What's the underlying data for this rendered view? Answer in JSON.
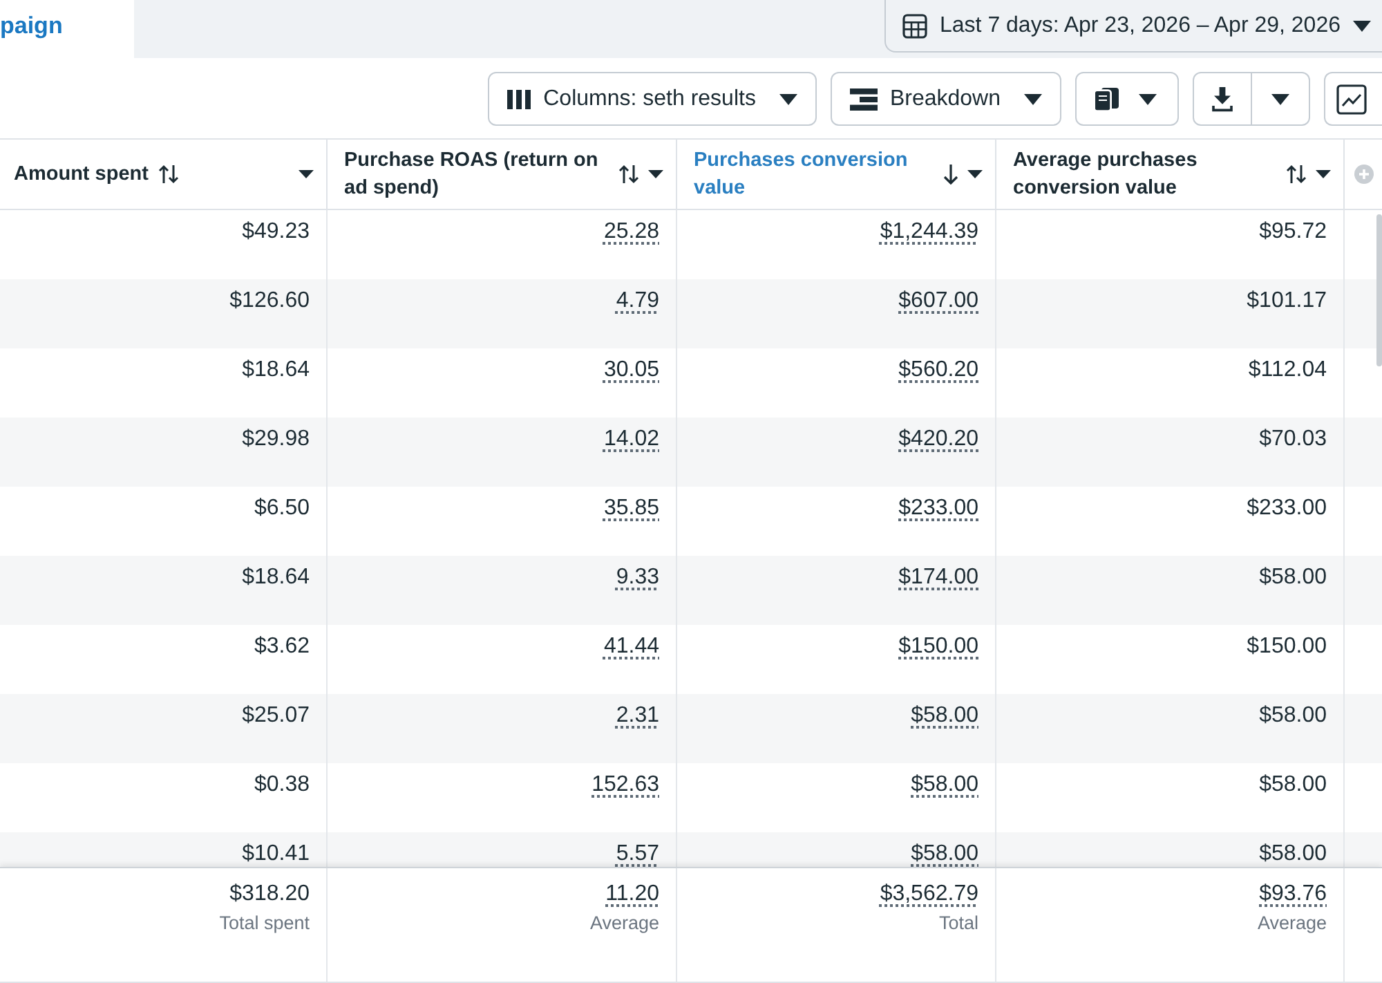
{
  "tabs": [
    {
      "label": "paign",
      "selected": true
    }
  ],
  "date_range": {
    "label": "Last 7 days: Apr 23, 2026 – Apr 29, 2026"
  },
  "toolbar": [
    {
      "kind": "columns",
      "label": "Columns: seth results"
    },
    {
      "kind": "breakdown",
      "label": "Breakdown"
    },
    {
      "kind": "reports"
    },
    {
      "kind": "export"
    },
    {
      "kind": "chart"
    }
  ],
  "table": {
    "columns": [
      {
        "label": "Amount spent",
        "sorted": false,
        "underlined": false
      },
      {
        "label": "Purchase ROAS (return on ad spend)",
        "sorted": false,
        "underlined": true
      },
      {
        "label": "Purchases conversion value",
        "sorted": true,
        "underlined": true
      },
      {
        "label": "Average purchases conversion value",
        "sorted": false,
        "underlined": false
      }
    ],
    "rows": [
      [
        "$49.23",
        "25.28",
        "$1,244.39",
        "$95.72"
      ],
      [
        "$126.60",
        "4.79",
        "$607.00",
        "$101.17"
      ],
      [
        "$18.64",
        "30.05",
        "$560.20",
        "$112.04"
      ],
      [
        "$29.98",
        "14.02",
        "$420.20",
        "$70.03"
      ],
      [
        "$6.50",
        "35.85",
        "$233.00",
        "$233.00"
      ],
      [
        "$18.64",
        "9.33",
        "$174.00",
        "$58.00"
      ],
      [
        "$3.62",
        "41.44",
        "$150.00",
        "$150.00"
      ],
      [
        "$25.07",
        "2.31",
        "$58.00",
        "$58.00"
      ],
      [
        "$0.38",
        "152.63",
        "$58.00",
        "$58.00"
      ],
      [
        "$10.41",
        "5.57",
        "$58.00",
        "$58.00"
      ]
    ],
    "totals": [
      {
        "value": "$318.20",
        "label": "Total spent",
        "underlined": false
      },
      {
        "value": "11.20",
        "label": "Average",
        "underlined": true
      },
      {
        "value": "$3,562.79",
        "label": "Total",
        "underlined": true
      },
      {
        "value": "$93.76",
        "label": "Average",
        "underlined": true
      }
    ]
  }
}
